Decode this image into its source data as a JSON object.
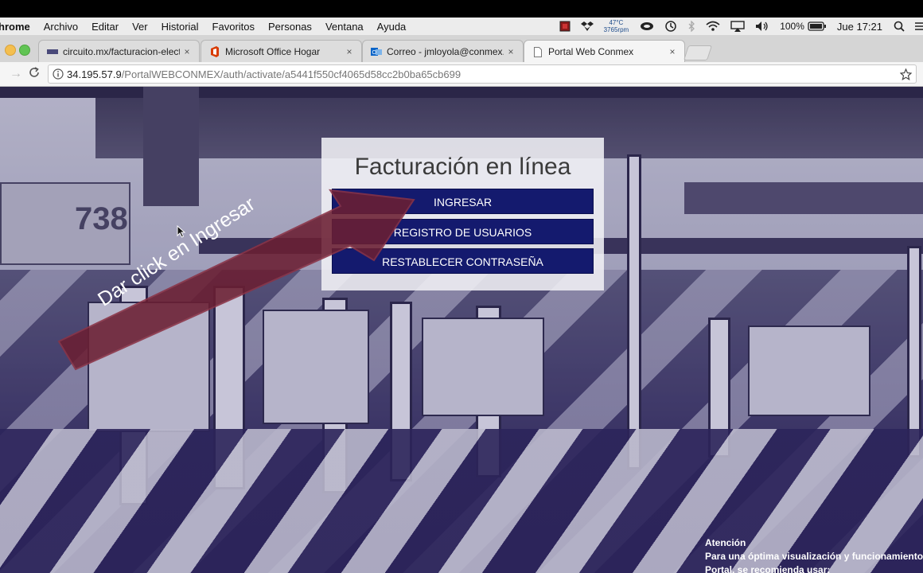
{
  "menubar": {
    "app": "hrome",
    "items": [
      "Archivo",
      "Editar",
      "Ver",
      "Historial",
      "Favoritos",
      "Personas",
      "Ventana",
      "Ayuda"
    ],
    "temp": "47°C",
    "rpm": "3765rpm",
    "battery": "100%",
    "clock": "Jue 17:21"
  },
  "tabs": [
    {
      "title": "circuito.mx/facturacion-electr",
      "close": "×",
      "icon": "page-icon"
    },
    {
      "title": "Microsoft Office Hogar",
      "close": "×",
      "icon": "office-icon"
    },
    {
      "title": "Correo - jmloyola@conmex.co",
      "close": "×",
      "icon": "outlook-icon"
    },
    {
      "title": "Portal Web Conmex",
      "close": "×",
      "icon": "document-icon",
      "active": true
    }
  ],
  "address": {
    "host": "34.195.57.9",
    "path": "/PortalWEBCONMEX/auth/activate/a5441f550cf4065d58cc2b0ba65cb699"
  },
  "background": {
    "sign_number": "738"
  },
  "card": {
    "title": "Facturación en línea",
    "buttons": [
      "INGRESAR",
      "REGISTRO DE USUARIOS",
      "RESTABLECER CONTRASEÑA"
    ]
  },
  "annotation": {
    "text": "Dar click en Ingresar",
    "color": "#6b1f33"
  },
  "attention": {
    "heading": "Atención",
    "line1": "Para una óptima visualización y funcionamiento d",
    "line2": "Portal, se recomienda usar:"
  },
  "colors": {
    "button": "#141a6e",
    "menubar": "#ececec"
  }
}
